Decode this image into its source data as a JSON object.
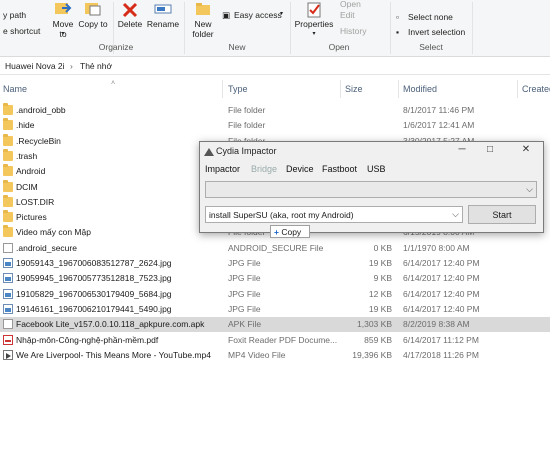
{
  "ribbon": {
    "copy_path": "y path",
    "paste_shortcut": "e shortcut",
    "move_to": "Move to",
    "copy_to": "Copy to",
    "delete": "Delete",
    "rename": "Rename",
    "new_folder": "New folder",
    "easy_access": "Easy access",
    "properties": "Properties",
    "open": "Open",
    "edit": "Edit",
    "history": "History",
    "select_none": "Select none",
    "invert_selection": "Invert selection",
    "group_organize": "Organize",
    "group_new": "New",
    "group_open": "Open",
    "group_select": "Select"
  },
  "breadcrumb": {
    "root": "Huawei Nova 2i",
    "current": "Thẻ nhớ"
  },
  "columns": {
    "name": "Name",
    "type": "Type",
    "size": "Size",
    "modified": "Modified",
    "created": "Created"
  },
  "files": [
    {
      "name": ".android_obb",
      "type": "File folder",
      "size": "",
      "modified": "8/1/2017 11:46 PM",
      "icon": "folder-icon"
    },
    {
      "name": ".hide",
      "type": "File folder",
      "size": "",
      "modified": "1/6/2017 12:41 AM",
      "icon": "folder-icon"
    },
    {
      "name": ".RecycleBin",
      "type": "File folder",
      "size": "",
      "modified": "3/30/2017 5:27 AM",
      "icon": "folder-icon"
    },
    {
      "name": ".trash",
      "type": "File folder",
      "size": "",
      "modified": "",
      "icon": "folder-icon"
    },
    {
      "name": "Android",
      "type": "",
      "size": "",
      "modified": "",
      "icon": "folder-icon"
    },
    {
      "name": "DCIM",
      "type": "",
      "size": "",
      "modified": "",
      "icon": "folder-icon"
    },
    {
      "name": "LOST.DIR",
      "type": "",
      "size": "",
      "modified": "",
      "icon": "folder-icon"
    },
    {
      "name": "Pictures",
      "type": "",
      "size": "",
      "modified": "",
      "icon": "folder-icon"
    },
    {
      "name": "Video mấy con Mập",
      "type": "File folder",
      "size": "",
      "modified": "6/15/2019 8:00 AM",
      "icon": "folder-icon"
    },
    {
      "name": ".android_secure",
      "type": "ANDROID_SECURE File",
      "size": "0 KB",
      "modified": "1/1/1970 8:00 AM",
      "icon": "file-icon"
    },
    {
      "name": "19059143_1967006083512787_2624.jpg",
      "type": "JPG File",
      "size": "19 KB",
      "modified": "6/14/2017 12:40 PM",
      "icon": "image-icon"
    },
    {
      "name": "19059945_1967005773512818_7523.jpg",
      "type": "JPG File",
      "size": "9 KB",
      "modified": "6/14/2017 12:40 PM",
      "icon": "image-icon"
    },
    {
      "name": "19105829_1967006530179409_5684.jpg",
      "type": "JPG File",
      "size": "12 KB",
      "modified": "6/14/2017 12:40 PM",
      "icon": "image-icon"
    },
    {
      "name": "19146161_1967006210179441_5490.jpg",
      "type": "JPG File",
      "size": "19 KB",
      "modified": "6/14/2017 12:40 PM",
      "icon": "image-icon"
    },
    {
      "name": "Facebook Lite_v157.0.0.10.118_apkpure.com.apk",
      "type": "APK File",
      "size": "1,303 KB",
      "modified": "8/2/2019 8:38 AM",
      "icon": "file-icon"
    },
    {
      "name": "Nhập-môn-Công-nghệ-phần-mềm.pdf",
      "type": "Foxit Reader PDF Docume...",
      "size": "859 KB",
      "modified": "6/14/2017 11:12 PM",
      "icon": "pdf-icon"
    },
    {
      "name": "We Are Liverpool- This Means More - YouTube.mp4",
      "type": "MP4 Video File",
      "size": "19,396 KB",
      "modified": "4/17/2018 11:26 PM",
      "icon": "video-icon"
    }
  ],
  "dialog": {
    "title": "Cydia Impactor",
    "menu": [
      "Impactor",
      "Bridge",
      "Device",
      "Fastboot",
      "USB"
    ],
    "device_value": "",
    "command": "install SuperSU (aka, root my Android)",
    "start": "Start"
  },
  "drag_tooltip": "Copy"
}
